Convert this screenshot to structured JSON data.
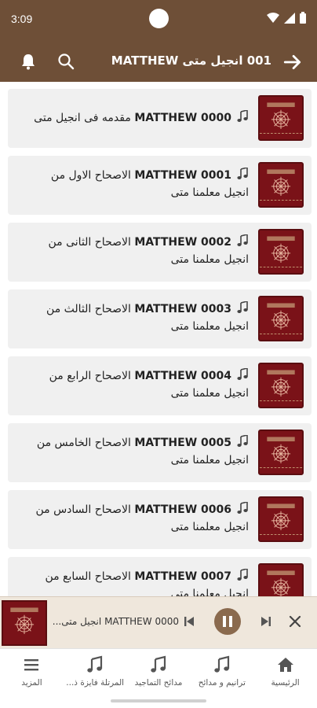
{
  "status_bar": {
    "time": "3:09"
  },
  "toolbar": {
    "title": "001 انجيل متى MATTHEW"
  },
  "tracks": [
    {
      "code": "MATTHEW 0000",
      "title": "مقدمه فى انجيل متى"
    },
    {
      "code": "MATTHEW 0001",
      "title": "الاصحاح الاول من انجيل معلمنا متى"
    },
    {
      "code": "MATTHEW 0002",
      "title": "الاصحاح الثانى من انجيل معلمنا متى"
    },
    {
      "code": "MATTHEW 0003",
      "title": "الاصحاح الثالث من انجيل معلمنا متى"
    },
    {
      "code": "MATTHEW 0004",
      "title": "الاصحاح الرابع من انجيل معلمنا متى"
    },
    {
      "code": "MATTHEW 0005",
      "title": "الاصحاح الخامس من انجيل معلمنا متى"
    },
    {
      "code": "MATTHEW 0006",
      "title": "الاصحاح السادس من انجيل معلمنا متى"
    },
    {
      "code": "MATTHEW 0007",
      "title": "الاصحاح السابع من انجيل معلمنا متى"
    }
  ],
  "player": {
    "title": "0000 MATTHEW انجيل متى...",
    "state": "playing"
  },
  "nav": [
    {
      "label": "الرئيسية",
      "icon": "home-icon"
    },
    {
      "label": "ترانيم و مدائح",
      "icon": "music-note-icon"
    },
    {
      "label": "مدائح التماجيد",
      "icon": "music-note-icon"
    },
    {
      "label": "المرتلة فايزة ذ...",
      "icon": "music-note-icon"
    },
    {
      "label": "المزيد",
      "icon": "menu-icon"
    }
  ],
  "colors": {
    "brand": "#6e4f37",
    "card": "#f0f0f0",
    "thumb": "#7a1218",
    "player_bg": "#efe7dc"
  }
}
